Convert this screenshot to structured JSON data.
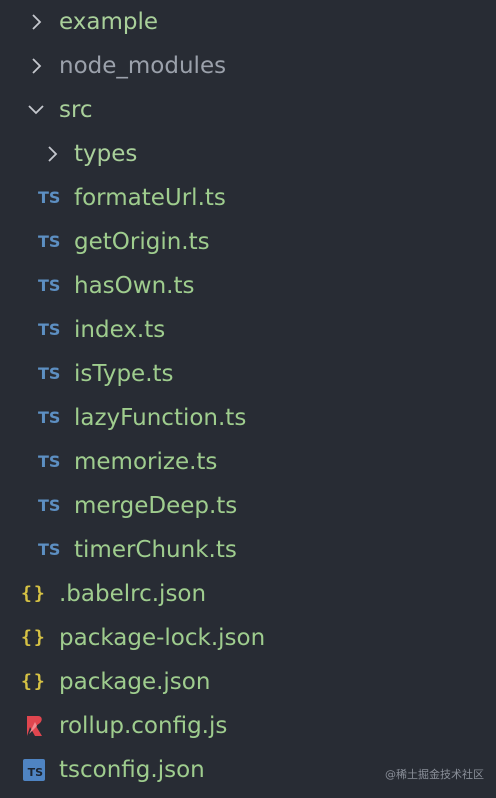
{
  "tree": {
    "example": "example",
    "node_modules": "node_modules",
    "src": "src",
    "types": "types",
    "src_files": [
      "formateUrl.ts",
      "getOrigin.ts",
      "hasOwn.ts",
      "index.ts",
      "isType.ts",
      "lazyFunction.ts",
      "memorize.ts",
      "mergeDeep.ts",
      "timerChunk.ts"
    ],
    "babelrc": ".babelrc.json",
    "package_lock": "package-lock.json",
    "package": "package.json",
    "rollup": "rollup.config.js",
    "tsconfig": "tsconfig.json"
  },
  "icons": {
    "ts_badge": "TS",
    "json_braces": "{}",
    "tsconfig_badge": "TS"
  },
  "watermark": "@稀土掘金技术社区",
  "colors": {
    "background": "#282c34",
    "folder_text": "#a9d09a",
    "ignored_text": "#9ba1ab",
    "file_text": "#9fcd8e",
    "ts_icon": "#5d8fc2",
    "json_icon": "#d6c244",
    "rollup_icon": "#e0464f",
    "tsconfig_icon": "#4f84c2"
  }
}
